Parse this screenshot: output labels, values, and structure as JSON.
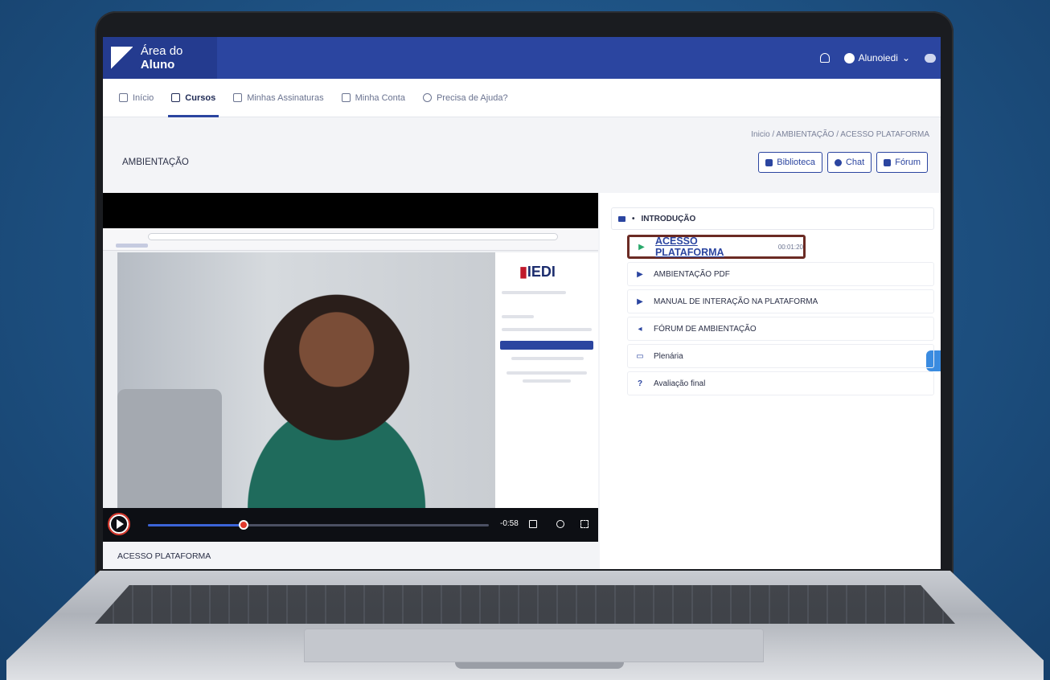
{
  "header": {
    "brand_pre": "Área do",
    "brand_bold": "Aluno",
    "user_name": "Alunoiedi"
  },
  "nav": [
    {
      "label": "Início",
      "active": false
    },
    {
      "label": "Cursos",
      "active": true
    },
    {
      "label": "Minhas Assinaturas",
      "active": false
    },
    {
      "label": "Minha Conta",
      "active": false
    },
    {
      "label": "Precisa de Ajuda?",
      "active": false
    }
  ],
  "breadcrumb": "Inicio / AMBIENTAÇÃO / ACESSO PLATAFORMA",
  "page_title": "AMBIENTAÇÃO",
  "actions": {
    "library": "Biblioteca",
    "chat": "Chat",
    "forum": "Fórum"
  },
  "video": {
    "embedded_logo": "IEDI",
    "remaining_time": "-0:58",
    "progress": 0.28,
    "caption": "ACESSO PLATAFORMA"
  },
  "course": {
    "section_title": "INTRODUÇÃO",
    "lessons": [
      {
        "title": "ACESSO PLATAFORMA",
        "duration": "00:01:20",
        "icon": "play-icon",
        "current": true
      },
      {
        "title": "AMBIENTAÇÃO PDF",
        "icon": "play-icon"
      },
      {
        "title": "MANUAL DE INTERAÇÃO NA PLATAFORMA",
        "icon": "play-icon"
      },
      {
        "title": "FÓRUM DE AMBIENTAÇÃO",
        "icon": "megaphone-icon"
      },
      {
        "title": "Plenária",
        "icon": "monitor-icon"
      },
      {
        "title": "Avaliação final",
        "icon": "question-icon"
      }
    ]
  },
  "colors": {
    "primary": "#2b45a0",
    "highlight_border": "#6b2b24",
    "play_green": "#28a86a",
    "progress_thumb": "#e03a2d"
  }
}
